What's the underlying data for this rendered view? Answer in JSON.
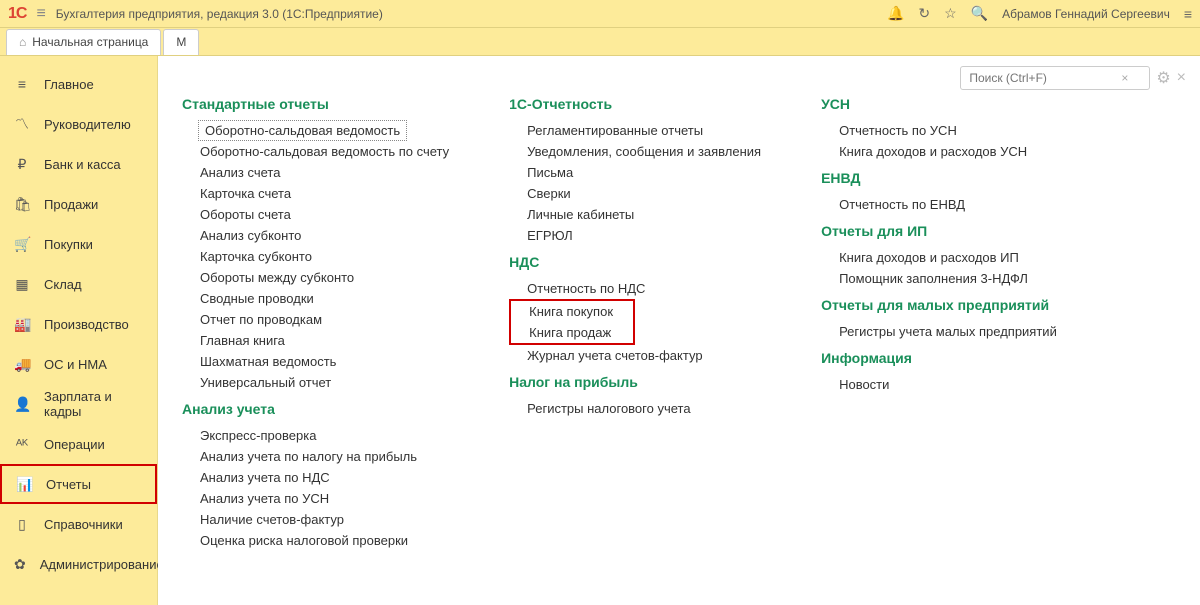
{
  "app": {
    "logo": "1С",
    "title": "Бухгалтерия предприятия, редакция 3.0  (1С:Предприятие)",
    "user": "Абрамов Геннадий Сергеевич"
  },
  "tabs": {
    "home": "Начальная страница",
    "other": "М"
  },
  "sidebar": [
    {
      "icon": "≡",
      "label": "Главное"
    },
    {
      "icon": "〽",
      "label": "Руководителю"
    },
    {
      "icon": "₽",
      "label": "Банк и касса"
    },
    {
      "icon": "🛍",
      "label": "Продажи"
    },
    {
      "icon": "🛒",
      "label": "Покупки"
    },
    {
      "icon": "▦",
      "label": "Склад"
    },
    {
      "icon": "🏭",
      "label": "Производство"
    },
    {
      "icon": "🚚",
      "label": "ОС и НМА"
    },
    {
      "icon": "👤",
      "label": "Зарплата и кадры"
    },
    {
      "icon": "ᴬᴷ",
      "label": "Операции"
    },
    {
      "icon": "📊",
      "label": "Отчеты"
    },
    {
      "icon": "▯",
      "label": "Справочники"
    },
    {
      "icon": "✿",
      "label": "Администрирование"
    }
  ],
  "search": {
    "placeholder": "Поиск (Ctrl+F)"
  },
  "col1": {
    "g1": "Стандартные отчеты",
    "g1_items": [
      "Оборотно-сальдовая ведомость",
      "Оборотно-сальдовая ведомость по счету",
      "Анализ счета",
      "Карточка счета",
      "Обороты счета",
      "Анализ субконто",
      "Карточка субконто",
      "Обороты между субконто",
      "Сводные проводки",
      "Отчет по проводкам",
      "Главная книга",
      "Шахматная ведомость",
      "Универсальный отчет"
    ],
    "g2": "Анализ учета",
    "g2_items": [
      "Экспресс-проверка",
      "Анализ учета по налогу на прибыль",
      "Анализ учета по НДС",
      "Анализ учета по УСН",
      "Наличие счетов-фактур",
      "Оценка риска налоговой проверки"
    ]
  },
  "col2": {
    "g1": "1С-Отчетность",
    "g1_items": [
      "Регламентированные отчеты",
      "Уведомления, сообщения и заявления",
      "Письма",
      "Сверки",
      "Личные кабинеты",
      "ЕГРЮЛ"
    ],
    "g2": "НДС",
    "g2_items_pre": "Отчетность по НДС",
    "g2_red1": "Книга покупок",
    "g2_red2": "Книга продаж",
    "g2_items_post": "Журнал учета счетов-фактур",
    "g3": "Налог на прибыль",
    "g3_items": [
      "Регистры налогового учета"
    ]
  },
  "col3": {
    "g1": "УСН",
    "g1_items": [
      "Отчетность по УСН",
      "Книга доходов и расходов УСН"
    ],
    "g2": "ЕНВД",
    "g2_items": [
      "Отчетность по ЕНВД"
    ],
    "g3": "Отчеты для ИП",
    "g3_items": [
      "Книга доходов и расходов ИП",
      "Помощник заполнения 3-НДФЛ"
    ],
    "g4": "Отчеты для малых предприятий",
    "g4_items": [
      "Регистры учета малых предприятий"
    ],
    "g5": "Информация",
    "g5_items": [
      "Новости"
    ]
  }
}
